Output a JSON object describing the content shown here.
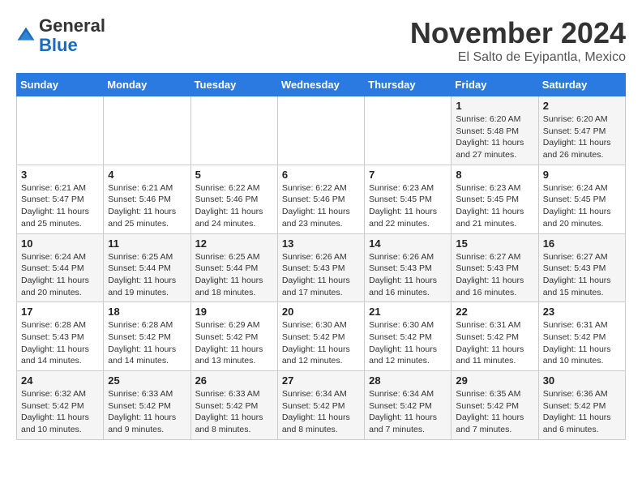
{
  "header": {
    "logo": {
      "general": "General",
      "blue": "Blue"
    },
    "title": "November 2024",
    "location": "El Salto de Eyipantla, Mexico"
  },
  "days_of_week": [
    "Sunday",
    "Monday",
    "Tuesday",
    "Wednesday",
    "Thursday",
    "Friday",
    "Saturday"
  ],
  "weeks": [
    [
      {
        "day": "",
        "info": ""
      },
      {
        "day": "",
        "info": ""
      },
      {
        "day": "",
        "info": ""
      },
      {
        "day": "",
        "info": ""
      },
      {
        "day": "",
        "info": ""
      },
      {
        "day": "1",
        "info": "Sunrise: 6:20 AM\nSunset: 5:48 PM\nDaylight: 11 hours and 27 minutes."
      },
      {
        "day": "2",
        "info": "Sunrise: 6:20 AM\nSunset: 5:47 PM\nDaylight: 11 hours and 26 minutes."
      }
    ],
    [
      {
        "day": "3",
        "info": "Sunrise: 6:21 AM\nSunset: 5:47 PM\nDaylight: 11 hours and 25 minutes."
      },
      {
        "day": "4",
        "info": "Sunrise: 6:21 AM\nSunset: 5:46 PM\nDaylight: 11 hours and 25 minutes."
      },
      {
        "day": "5",
        "info": "Sunrise: 6:22 AM\nSunset: 5:46 PM\nDaylight: 11 hours and 24 minutes."
      },
      {
        "day": "6",
        "info": "Sunrise: 6:22 AM\nSunset: 5:46 PM\nDaylight: 11 hours and 23 minutes."
      },
      {
        "day": "7",
        "info": "Sunrise: 6:23 AM\nSunset: 5:45 PM\nDaylight: 11 hours and 22 minutes."
      },
      {
        "day": "8",
        "info": "Sunrise: 6:23 AM\nSunset: 5:45 PM\nDaylight: 11 hours and 21 minutes."
      },
      {
        "day": "9",
        "info": "Sunrise: 6:24 AM\nSunset: 5:45 PM\nDaylight: 11 hours and 20 minutes."
      }
    ],
    [
      {
        "day": "10",
        "info": "Sunrise: 6:24 AM\nSunset: 5:44 PM\nDaylight: 11 hours and 20 minutes."
      },
      {
        "day": "11",
        "info": "Sunrise: 6:25 AM\nSunset: 5:44 PM\nDaylight: 11 hours and 19 minutes."
      },
      {
        "day": "12",
        "info": "Sunrise: 6:25 AM\nSunset: 5:44 PM\nDaylight: 11 hours and 18 minutes."
      },
      {
        "day": "13",
        "info": "Sunrise: 6:26 AM\nSunset: 5:43 PM\nDaylight: 11 hours and 17 minutes."
      },
      {
        "day": "14",
        "info": "Sunrise: 6:26 AM\nSunset: 5:43 PM\nDaylight: 11 hours and 16 minutes."
      },
      {
        "day": "15",
        "info": "Sunrise: 6:27 AM\nSunset: 5:43 PM\nDaylight: 11 hours and 16 minutes."
      },
      {
        "day": "16",
        "info": "Sunrise: 6:27 AM\nSunset: 5:43 PM\nDaylight: 11 hours and 15 minutes."
      }
    ],
    [
      {
        "day": "17",
        "info": "Sunrise: 6:28 AM\nSunset: 5:43 PM\nDaylight: 11 hours and 14 minutes."
      },
      {
        "day": "18",
        "info": "Sunrise: 6:28 AM\nSunset: 5:42 PM\nDaylight: 11 hours and 14 minutes."
      },
      {
        "day": "19",
        "info": "Sunrise: 6:29 AM\nSunset: 5:42 PM\nDaylight: 11 hours and 13 minutes."
      },
      {
        "day": "20",
        "info": "Sunrise: 6:30 AM\nSunset: 5:42 PM\nDaylight: 11 hours and 12 minutes."
      },
      {
        "day": "21",
        "info": "Sunrise: 6:30 AM\nSunset: 5:42 PM\nDaylight: 11 hours and 12 minutes."
      },
      {
        "day": "22",
        "info": "Sunrise: 6:31 AM\nSunset: 5:42 PM\nDaylight: 11 hours and 11 minutes."
      },
      {
        "day": "23",
        "info": "Sunrise: 6:31 AM\nSunset: 5:42 PM\nDaylight: 11 hours and 10 minutes."
      }
    ],
    [
      {
        "day": "24",
        "info": "Sunrise: 6:32 AM\nSunset: 5:42 PM\nDaylight: 11 hours and 10 minutes."
      },
      {
        "day": "25",
        "info": "Sunrise: 6:33 AM\nSunset: 5:42 PM\nDaylight: 11 hours and 9 minutes."
      },
      {
        "day": "26",
        "info": "Sunrise: 6:33 AM\nSunset: 5:42 PM\nDaylight: 11 hours and 8 minutes."
      },
      {
        "day": "27",
        "info": "Sunrise: 6:34 AM\nSunset: 5:42 PM\nDaylight: 11 hours and 8 minutes."
      },
      {
        "day": "28",
        "info": "Sunrise: 6:34 AM\nSunset: 5:42 PM\nDaylight: 11 hours and 7 minutes."
      },
      {
        "day": "29",
        "info": "Sunrise: 6:35 AM\nSunset: 5:42 PM\nDaylight: 11 hours and 7 minutes."
      },
      {
        "day": "30",
        "info": "Sunrise: 6:36 AM\nSunset: 5:42 PM\nDaylight: 11 hours and 6 minutes."
      }
    ]
  ]
}
